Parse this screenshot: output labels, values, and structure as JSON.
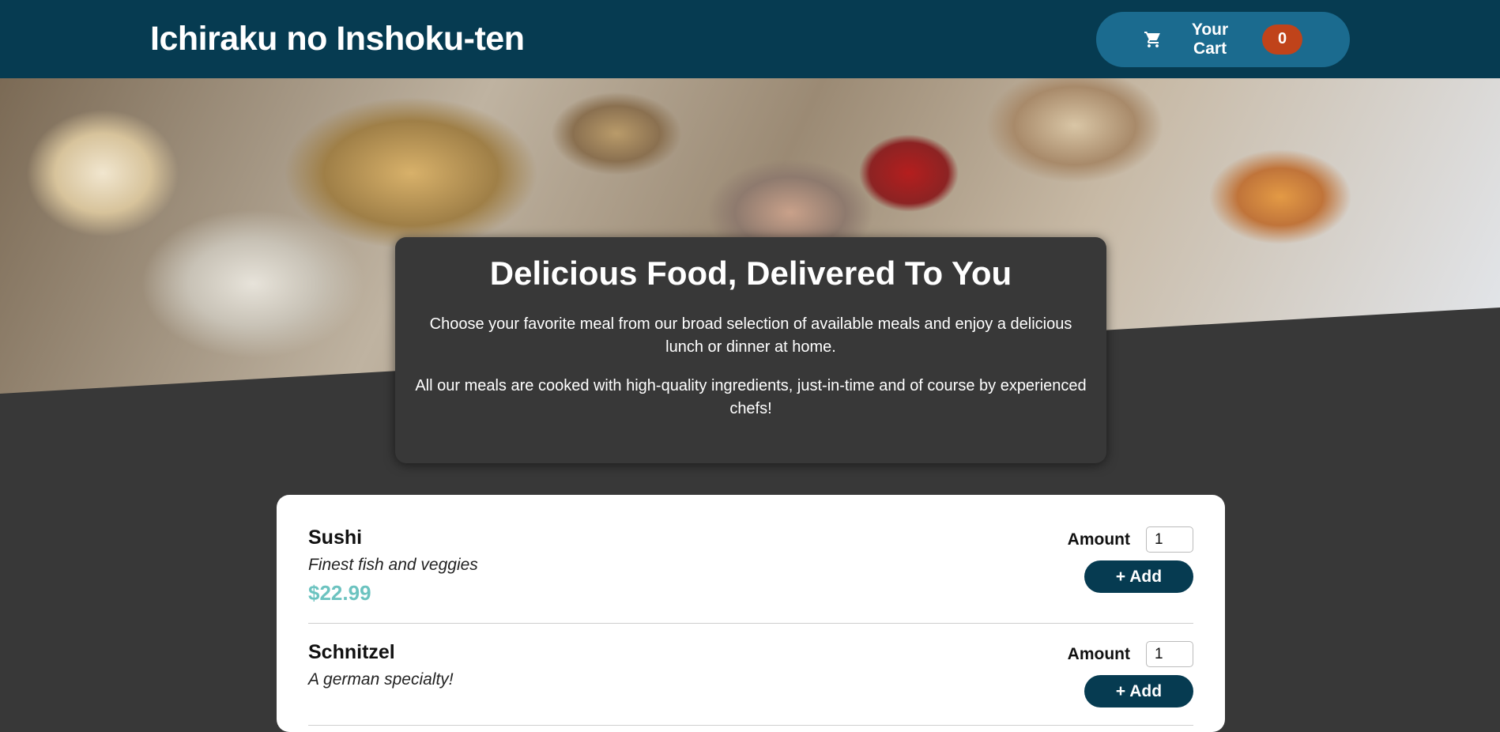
{
  "header": {
    "title": "Ichiraku no Inshoku-ten",
    "cart": {
      "label": "Your Cart",
      "count": "0",
      "icon": "cart-icon"
    }
  },
  "summary": {
    "title": "Delicious Food, Delivered To You",
    "paragraph_1": "Choose your favorite meal from our broad selection of available meals and enjoy a delicious lunch or dinner at home.",
    "paragraph_2": "All our meals are cooked with high-quality ingredients, just-in-time and of course by experienced chefs!"
  },
  "meals": [
    {
      "name": "Sushi",
      "description": "Finest fish and veggies",
      "price": "$22.99",
      "amount_label": "Amount",
      "amount_value": "1",
      "add_label": "+ Add"
    },
    {
      "name": "Schnitzel",
      "description": "A german specialty!",
      "price": "",
      "amount_label": "Amount",
      "amount_value": "1",
      "add_label": "+ Add"
    }
  ],
  "colors": {
    "header_bg": "#063b51",
    "cart_button": "#1b6b8f",
    "cart_badge": "#c0431a",
    "page_bg": "#383838",
    "price": "#6cc3c0",
    "add_button": "#063b51"
  }
}
